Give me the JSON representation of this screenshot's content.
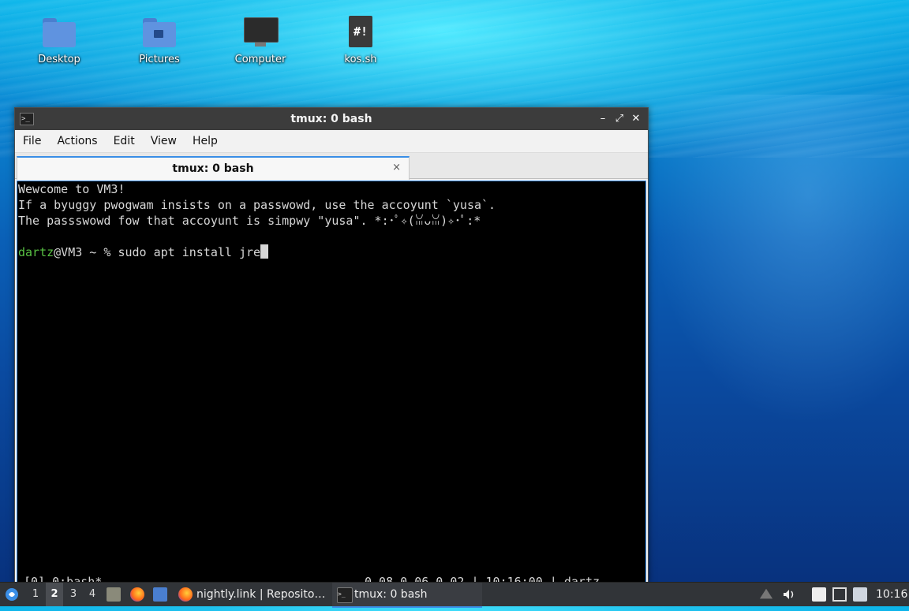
{
  "desktop": {
    "icons": [
      {
        "label": "Desktop",
        "icon": "folder-icon"
      },
      {
        "label": "Pictures",
        "icon": "pictures-folder-icon"
      },
      {
        "label": "Computer",
        "icon": "computer-icon"
      },
      {
        "label": "kos.sh",
        "icon": "shell-script-icon"
      }
    ]
  },
  "window": {
    "title": "tmux: 0 bash",
    "controls": {
      "minimize": "–",
      "maximize": "⤢",
      "close": "✕"
    },
    "menu": [
      "File",
      "Actions",
      "Edit",
      "View",
      "Help"
    ],
    "tab": {
      "label": "tmux: 0 bash",
      "close": "×"
    },
    "terminal": {
      "lines": [
        "Wewcome to VM3!",
        "If a byuggy pwogwam insists on a passwowd, use the accoyunt `yusa`.",
        "The passswowd fow that accoyunt is simpwy \"yusa\". *:･ﾟ✧(ꈍᴗꈍ)✧･ﾟ:*",
        ""
      ],
      "prompt_user": "dartz",
      "prompt_rest": "@VM3 ~ % ",
      "command": "sudo apt install jre",
      "status_left": "[0] 0:bash*",
      "status_right": "0.08 0.06 0.02 | 10:16:00 | dartz"
    }
  },
  "taskbar": {
    "workspaces": [
      "1",
      "2",
      "3",
      "4"
    ],
    "active_workspace": "2",
    "tasks": [
      {
        "label": "nightly.link | Reposito…",
        "icon": "firefox-icon"
      },
      {
        "label": "tmux: 0 bash",
        "icon": "terminal-icon"
      }
    ],
    "clock": "10:16"
  },
  "colors": {
    "accent": "#3a8ee6",
    "prompt_user": "#58c043",
    "terminal_bg": "#000000",
    "titlebar": "#3c3c3c",
    "taskbar": "#313438"
  }
}
